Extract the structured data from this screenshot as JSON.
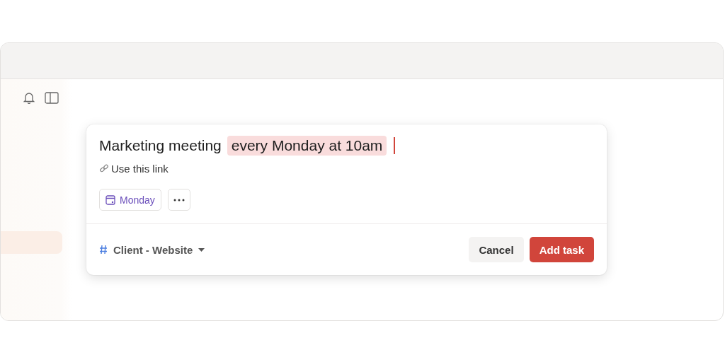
{
  "task_editor": {
    "title": "Marketing meeting",
    "recurrence": "every Monday at 10am",
    "description": "Use this link",
    "date_chip": "Monday",
    "project": "Client - Website",
    "buttons": [
      {
        "label": "Cancel",
        "kind": "secondary"
      },
      {
        "label": "Add task",
        "kind": "primary"
      }
    ]
  }
}
